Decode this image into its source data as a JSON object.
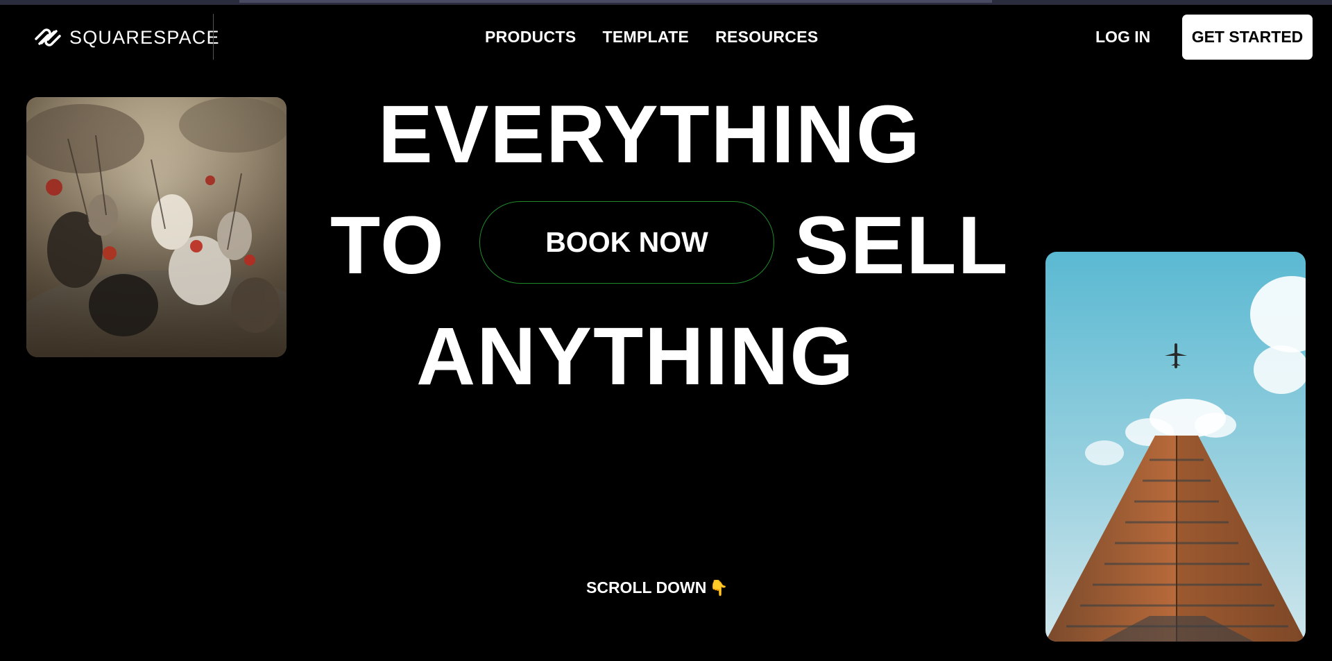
{
  "header": {
    "logo_text": "SQUARESPACE",
    "nav": [
      "PRODUCTS",
      "TEMPLATE",
      "RESOURCES"
    ],
    "login_label": "LOG IN",
    "cta_label": "GET STARTED"
  },
  "hero": {
    "line1": "EVERYTHING",
    "line2_left": "TO",
    "line2_button": "BOOK NOW",
    "line2_right": "SELL",
    "line3": "ANYTHING"
  },
  "scroll": {
    "label": "SCROLL DOWN",
    "icon": "pointing-down-hand-icon"
  },
  "images": {
    "left": "battle-painting-image",
    "right": "skyscraper-airplane-image"
  },
  "colors": {
    "background": "#000000",
    "text": "#ffffff",
    "button_border": "#1f8a2a",
    "hand": "#f2b51e"
  }
}
